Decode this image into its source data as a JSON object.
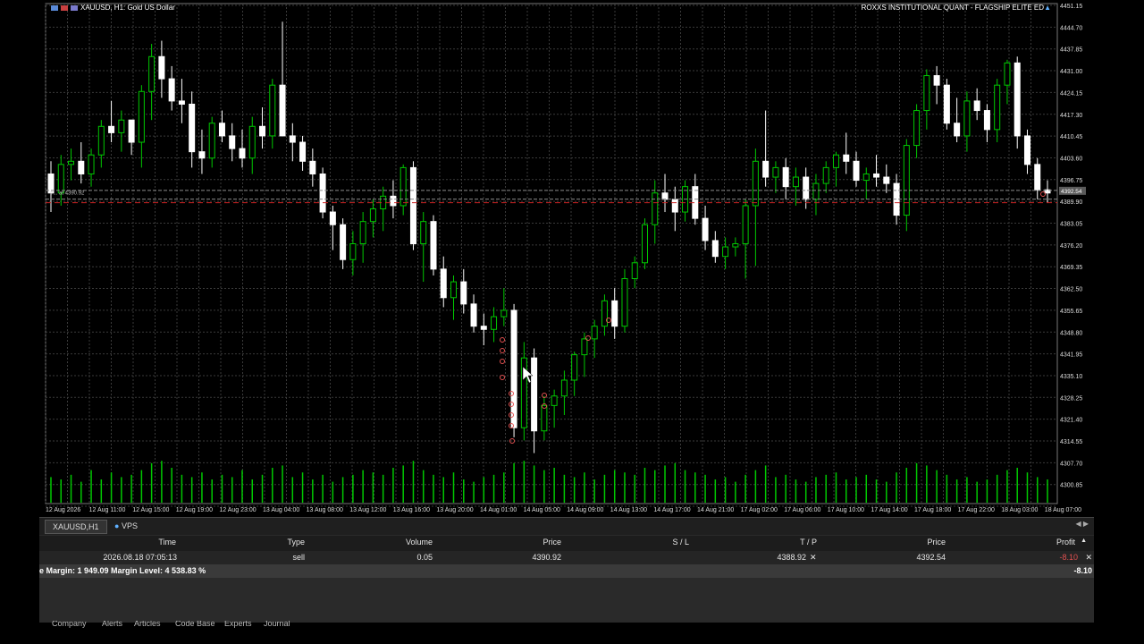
{
  "chart": {
    "symbol_title": "XAUUSD, H1:  Gold US Dollar",
    "ea_title": "ROXXS INSTITUTIONAL QUANT - FLAGSHIP ELITE ED",
    "order_line_label": "#... at 4390.92",
    "price_tag_label": "4392.54",
    "price_levels": [
      "4451.15",
      "4444.70",
      "4437.85",
      "4431.00",
      "4424.15",
      "4417.30",
      "4410.45",
      "4403.60",
      "4396.75",
      "4389.90",
      "4383.05",
      "4376.20",
      "4369.35",
      "4362.50",
      "4355.65",
      "4348.80",
      "4341.95",
      "4335.10",
      "4328.25",
      "4321.40",
      "4314.55",
      "4307.70",
      "4300.85"
    ],
    "time_labels": [
      "12 Aug 2026",
      "12 Aug 11:00",
      "12 Aug 15:00",
      "12 Aug 19:00",
      "12 Aug 23:00",
      "13 Aug 04:00",
      "13 Aug 08:00",
      "13 Aug 12:00",
      "13 Aug 16:00",
      "13 Aug 20:00",
      "14 Aug 01:00",
      "14 Aug 05:00",
      "14 Aug 09:00",
      "14 Aug 13:00",
      "14 Aug 17:00",
      "14 Aug 21:00",
      "17 Aug 02:00",
      "17 Aug 06:00",
      "17 Aug 10:00",
      "17 Aug 14:00",
      "17 Aug 18:00",
      "17 Aug 22:00",
      "18 Aug 03:00",
      "18 Aug 07:00"
    ],
    "colors": {
      "bull": "#00c800",
      "bear": "#ffffff",
      "grid": "#3a3a3a",
      "order_line": "#cc2222",
      "volume": "#00c800"
    }
  },
  "chart_data": {
    "type": "candlestick",
    "ylim": [
      4300.85,
      4451.15
    ],
    "ohlc": [
      [
        4398,
        4402,
        4386,
        4392
      ],
      [
        4392,
        4404,
        4388,
        4401
      ],
      [
        4401,
        4406,
        4396,
        4402
      ],
      [
        4402,
        4408,
        4395,
        4398
      ],
      [
        4398,
        4406,
        4394,
        4404
      ],
      [
        4404,
        4415,
        4400,
        4413
      ],
      [
        4413,
        4421,
        4408,
        4411
      ],
      [
        4411,
        4418,
        4405,
        4415
      ],
      [
        4415,
        4414,
        4404,
        4408
      ],
      [
        4408,
        4426,
        4400,
        4424
      ],
      [
        4424,
        4439,
        4415,
        4435
      ],
      [
        4435,
        4440,
        4422,
        4428
      ],
      [
        4428,
        4432,
        4418,
        4421
      ],
      [
        4421,
        4428,
        4414,
        4420
      ],
      [
        4420,
        4424,
        4400,
        4405
      ],
      [
        4405,
        4412,
        4398,
        4403
      ],
      [
        4403,
        4416,
        4400,
        4414
      ],
      [
        4414,
        4418,
        4408,
        4410
      ],
      [
        4410,
        4414,
        4402,
        4406
      ],
      [
        4406,
        4412,
        4400,
        4403
      ],
      [
        4403,
        4416,
        4398,
        4413
      ],
      [
        4413,
        4419,
        4406,
        4410
      ],
      [
        4410,
        4428,
        4406,
        4426
      ],
      [
        4426,
        4446,
        4418,
        4410
      ],
      [
        4410,
        4414,
        4402,
        4408
      ],
      [
        4408,
        4410,
        4399,
        4402
      ],
      [
        4402,
        4406,
        4394,
        4398
      ],
      [
        4398,
        4400,
        4384,
        4386
      ],
      [
        4386,
        4388,
        4374,
        4382
      ],
      [
        4382,
        4384,
        4368,
        4371
      ],
      [
        4371,
        4380,
        4366,
        4376
      ],
      [
        4376,
        4386,
        4370,
        4383
      ],
      [
        4383,
        4390,
        4378,
        4387
      ],
      [
        4387,
        4394,
        4380,
        4391
      ],
      [
        4391,
        4396,
        4384,
        4388
      ],
      [
        4388,
        4401,
        4385,
        4400
      ],
      [
        4400,
        4402,
        4374,
        4376
      ],
      [
        4376,
        4386,
        4364,
        4383
      ],
      [
        4383,
        4385,
        4366,
        4368
      ],
      [
        4368,
        4372,
        4356,
        4359
      ],
      [
        4359,
        4366,
        4352,
        4364
      ],
      [
        4364,
        4368,
        4354,
        4357
      ],
      [
        4357,
        4360,
        4348,
        4350
      ],
      [
        4350,
        4354,
        4344,
        4349
      ],
      [
        4349,
        4356,
        4345,
        4353
      ],
      [
        4353,
        4362,
        4350,
        4355
      ],
      [
        4355,
        4357,
        4315,
        4318
      ],
      [
        4318,
        4345,
        4314,
        4340
      ],
      [
        4340,
        4343,
        4310,
        4317
      ],
      [
        4317,
        4328,
        4314,
        4325
      ],
      [
        4325,
        4330,
        4318,
        4328
      ],
      [
        4328,
        4336,
        4322,
        4333
      ],
      [
        4333,
        4342,
        4328,
        4341
      ],
      [
        4341,
        4348,
        4334,
        4346
      ],
      [
        4346,
        4352,
        4340,
        4350
      ],
      [
        4350,
        4360,
        4347,
        4358
      ],
      [
        4358,
        4362,
        4346,
        4350
      ],
      [
        4350,
        4368,
        4348,
        4365
      ],
      [
        4365,
        4372,
        4362,
        4370
      ],
      [
        4370,
        4384,
        4368,
        4382
      ],
      [
        4382,
        4396,
        4376,
        4392
      ],
      [
        4392,
        4398,
        4386,
        4390
      ],
      [
        4390,
        4394,
        4380,
        4386
      ],
      [
        4386,
        4396,
        4383,
        4394
      ],
      [
        4394,
        4398,
        4382,
        4384
      ],
      [
        4384,
        4388,
        4374,
        4377
      ],
      [
        4377,
        4380,
        4370,
        4372
      ],
      [
        4372,
        4378,
        4368,
        4375
      ],
      [
        4375,
        4378,
        4372,
        4376
      ],
      [
        4376,
        4390,
        4365,
        4388
      ],
      [
        4388,
        4406,
        4369,
        4402
      ],
      [
        4402,
        4418,
        4394,
        4397
      ],
      [
        4397,
        4402,
        4392,
        4400
      ],
      [
        4400,
        4403,
        4390,
        4394
      ],
      [
        4394,
        4400,
        4388,
        4397
      ],
      [
        4397,
        4400,
        4387,
        4390
      ],
      [
        4390,
        4398,
        4385,
        4395
      ],
      [
        4395,
        4402,
        4392,
        4400
      ],
      [
        4400,
        4405,
        4394,
        4404
      ],
      [
        4404,
        4411,
        4398,
        4402
      ],
      [
        4402,
        4405,
        4394,
        4396
      ],
      [
        4396,
        4400,
        4390,
        4398
      ],
      [
        4398,
        4404,
        4394,
        4397
      ],
      [
        4397,
        4401,
        4392,
        4395
      ],
      [
        4395,
        4398,
        4382,
        4385
      ],
      [
        4385,
        4409,
        4380,
        4407
      ],
      [
        4407,
        4420,
        4403,
        4418
      ],
      [
        4418,
        4431,
        4412,
        4429
      ],
      [
        4429,
        4432,
        4420,
        4426
      ],
      [
        4426,
        4428,
        4412,
        4414
      ],
      [
        4414,
        4422,
        4408,
        4410
      ],
      [
        4410,
        4424,
        4405,
        4421
      ],
      [
        4421,
        4425,
        4415,
        4418
      ],
      [
        4418,
        4420,
        4408,
        4412
      ],
      [
        4412,
        4428,
        4408,
        4426
      ],
      [
        4426,
        4434,
        4420,
        4433
      ],
      [
        4433,
        4435,
        4406,
        4410
      ],
      [
        4410,
        4412,
        4398,
        4401
      ],
      [
        4401,
        4403,
        4390,
        4393
      ],
      [
        4393,
        4396,
        4389,
        4392
      ]
    ],
    "volume": [
      0.55,
      0.5,
      0.6,
      0.45,
      0.7,
      0.5,
      0.65,
      0.55,
      0.6,
      0.7,
      0.85,
      0.9,
      0.75,
      0.6,
      0.55,
      0.65,
      0.5,
      0.6,
      0.55,
      0.7,
      0.5,
      0.6,
      0.75,
      0.8,
      0.55,
      0.65,
      0.5,
      0.6,
      0.45,
      0.55,
      0.6,
      0.7,
      0.65,
      0.6,
      0.75,
      0.8,
      0.9,
      0.7,
      0.6,
      0.55,
      0.65,
      0.5,
      0.45,
      0.55,
      0.6,
      0.65,
      0.85,
      0.9,
      0.8,
      0.7,
      0.75,
      0.6,
      0.55,
      0.65,
      0.5,
      0.6,
      0.7,
      0.65,
      0.6,
      0.75,
      0.7,
      0.8,
      0.85,
      0.7,
      0.65,
      0.6,
      0.5,
      0.55,
      0.45,
      0.6,
      0.7,
      0.8,
      0.55,
      0.6,
      0.5,
      0.45,
      0.55,
      0.6,
      0.65,
      0.5,
      0.55,
      0.6,
      0.5,
      0.45,
      0.65,
      0.75,
      0.85,
      0.8,
      0.7,
      0.6,
      0.5,
      0.55,
      0.45,
      0.5,
      0.6,
      0.7,
      0.75,
      0.65,
      0.55,
      0.5
    ]
  },
  "tabs": {
    "chart_tab": "XAUUSD,H1",
    "vps_tab": "VPS"
  },
  "terminal": {
    "headers": {
      "time": "Time",
      "type": "Type",
      "volume": "Volume",
      "price": "Price",
      "sl": "S / L",
      "tp": "T / P",
      "price2": "Price",
      "profit": "Profit"
    },
    "row": {
      "time": "2026.08.18 07:05:13",
      "type": "sell",
      "volume": "0.05",
      "price": "4390.92",
      "tp": "4388.92",
      "price2": "4392.54",
      "profit": "-8.10"
    },
    "summary": {
      "text": "e Margin: 1 949.09  Margin Level: 4 538.83 %",
      "profit": "-8.10"
    },
    "bottom_tabs": [
      "Company",
      "Alerts",
      "Articles",
      "Code Base",
      "Experts",
      "Journal"
    ]
  }
}
